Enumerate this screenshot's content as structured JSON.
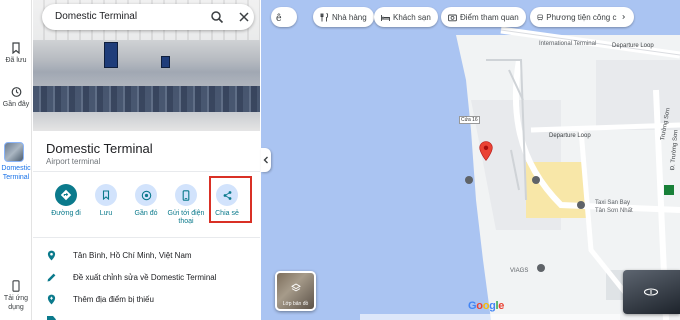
{
  "search": {
    "value": "Domestic Terminal"
  },
  "rail": {
    "saved": "Đã lưu",
    "recent": "Gần đây",
    "place": "Domestic Terminal",
    "apps": "Tải ứng dụng"
  },
  "place": {
    "title": "Domestic Terminal",
    "category": "Airport terminal"
  },
  "actions": [
    {
      "label": "Đường đi",
      "icon": "directions-icon"
    },
    {
      "label": "Lưu",
      "icon": "bookmark-icon"
    },
    {
      "label": "Gần đó",
      "icon": "nearby-icon"
    },
    {
      "label": "Gửi tới điện thoại",
      "icon": "phone-icon"
    },
    {
      "label": "Chia sẻ",
      "icon": "share-icon"
    }
  ],
  "info": [
    {
      "text": "Tân Bình, Hồ Chí Minh, Việt Nam",
      "icon": "location-pin-icon"
    },
    {
      "text": "Đề xuất chỉnh sửa về Domestic Terminal",
      "icon": "edit-pencil-icon"
    },
    {
      "text": "Thêm địa điểm bị thiếu",
      "icon": "add-place-icon"
    }
  ],
  "chips": [
    {
      "label": "Nhà hàng",
      "icon": "restaurant-icon"
    },
    {
      "label": "Khách sạn",
      "icon": "hotel-icon"
    },
    {
      "label": "Điểm tham quan",
      "icon": "camera-icon"
    },
    {
      "label": "Phương tiện công c",
      "icon": "transit-icon"
    }
  ],
  "map": {
    "labels": {
      "intl": "International Terminal",
      "departure": "Departure Loop",
      "departure2": "Departure Loop",
      "truong_son": "Đ. Trường Sơn",
      "truong_son2": "Trường Sơn",
      "taxi": "Taxi San Bay",
      "taxi2": "Tân Sơn Nhất",
      "viags": "VIAGS",
      "gate": "Cửa 16"
    },
    "layer_label": "Lớp bản đồ",
    "google": "Google"
  },
  "colors": {
    "accent": "#0b7a8c",
    "water": "#aac4f2",
    "highlight": "#d93025"
  }
}
